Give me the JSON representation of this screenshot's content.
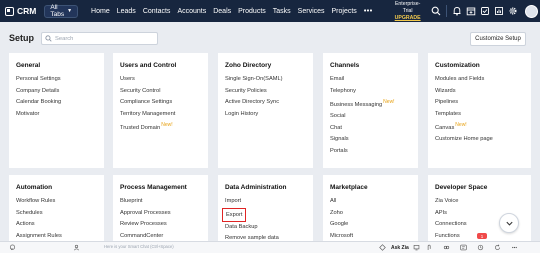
{
  "topbar": {
    "app_name": "CRM",
    "all_tabs_label": "All Tabs",
    "nav": [
      "Home",
      "Leads",
      "Contacts",
      "Accounts",
      "Deals",
      "Products",
      "Tasks",
      "Services",
      "Projects"
    ],
    "more_label": "•••",
    "trial_label": "Enterprise-Trial",
    "upgrade_label": "UPGRADE",
    "icons": [
      "search-icon",
      "bell-icon",
      "calendar-add-icon",
      "checklist-icon",
      "chart-icon",
      "gear-icon",
      "avatar",
      "apps-grid-icon"
    ]
  },
  "setup": {
    "title": "Setup",
    "search_placeholder": "Search",
    "customize_label": "Customize Setup"
  },
  "cards": [
    {
      "title": "General",
      "items": [
        {
          "label": "Personal Settings"
        },
        {
          "label": "Company Details"
        },
        {
          "label": "Calendar Booking"
        },
        {
          "label": "Motivator"
        }
      ]
    },
    {
      "title": "Users and Control",
      "items": [
        {
          "label": "Users"
        },
        {
          "label": "Security Control"
        },
        {
          "label": "Compliance Settings"
        },
        {
          "label": "Territory Management"
        },
        {
          "label": "Trusted Domain",
          "badge": "New!"
        }
      ]
    },
    {
      "title": "Zoho Directory",
      "items": [
        {
          "label": "Single Sign-On(SAML)"
        },
        {
          "label": "Security Policies"
        },
        {
          "label": "Active Directory Sync"
        },
        {
          "label": "Login History"
        }
      ]
    },
    {
      "title": "Channels",
      "items": [
        {
          "label": "Email"
        },
        {
          "label": "Telephony"
        },
        {
          "label": "Business Messaging",
          "badge": "New!"
        },
        {
          "label": "Social"
        },
        {
          "label": "Chat"
        },
        {
          "label": "Signals"
        },
        {
          "label": "Portals"
        }
      ]
    },
    {
      "title": "Customization",
      "items": [
        {
          "label": "Modules and Fields"
        },
        {
          "label": "Wizards"
        },
        {
          "label": "Pipelines"
        },
        {
          "label": "Templates"
        },
        {
          "label": "Canvas",
          "badge": "New!"
        },
        {
          "label": "Customize Home page"
        }
      ]
    },
    {
      "title": "Automation",
      "items": [
        {
          "label": "Workflow Rules"
        },
        {
          "label": "Schedules"
        },
        {
          "label": "Actions"
        },
        {
          "label": "Assignment Rules"
        }
      ]
    },
    {
      "title": "Process Management",
      "items": [
        {
          "label": "Blueprint"
        },
        {
          "label": "Approval Processes"
        },
        {
          "label": "Review Processes"
        },
        {
          "label": "CommandCenter"
        }
      ]
    },
    {
      "title": "Data Administration",
      "items": [
        {
          "label": "Import"
        },
        {
          "label": "Export",
          "highlighted": true
        },
        {
          "label": "Data Backup"
        },
        {
          "label": "Remove sample data"
        }
      ]
    },
    {
      "title": "Marketplace",
      "items": [
        {
          "label": "All"
        },
        {
          "label": "Zoho"
        },
        {
          "label": "Google"
        },
        {
          "label": "Microsoft"
        }
      ]
    },
    {
      "title": "Developer Space",
      "items": [
        {
          "label": "Zia Voice"
        },
        {
          "label": "APIs"
        },
        {
          "label": "Connections"
        },
        {
          "label": "Functions",
          "badge_count": "1"
        }
      ]
    }
  ],
  "bottombar": {
    "smartchat_placeholder": "Here is your Smart Chat (Ctrl+Space)",
    "ask_zia_label": "Ask Zia",
    "notification_count": "1"
  },
  "colors": {
    "topbar": "#17263f",
    "highlight_border": "#e02424",
    "new_badge": "#e8a316",
    "page_bg": "#e9ecf1"
  }
}
